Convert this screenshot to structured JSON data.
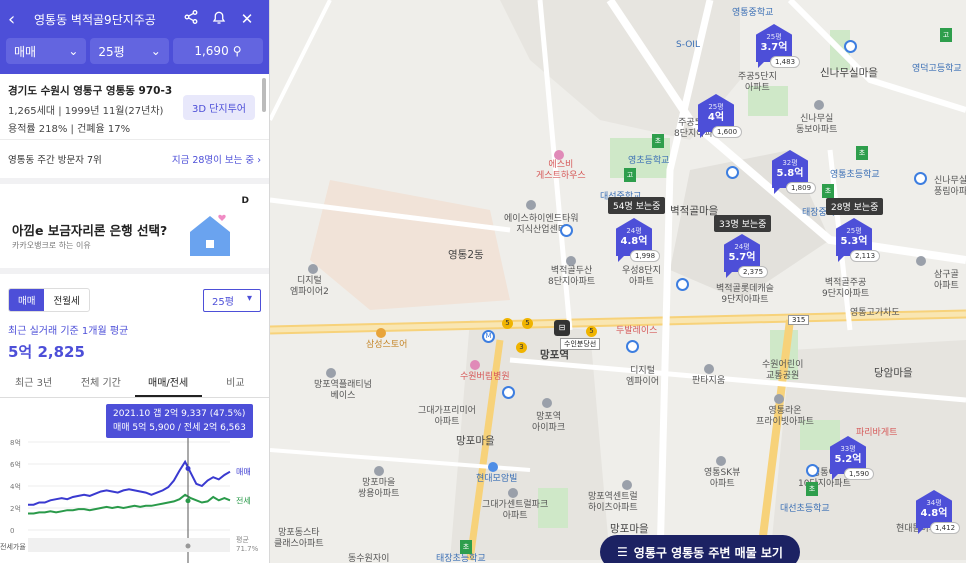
{
  "panel": {
    "header": {
      "title": "영통동 벽적골9단지주공",
      "back_icon": "‹",
      "share_icon": "share",
      "bell_icon": "bell",
      "close_icon": "✕"
    },
    "filters": {
      "deal_type": "매매",
      "area": "25평",
      "count": "1,690"
    },
    "address": {
      "line1": "경기도 수원시 영통구 영통동 970-3",
      "line2": "1,265세대 | 1999년 11월(27년차)",
      "line3": "용적률 218% | 건폐율 17%",
      "btn_3d": "3D 단지투어"
    },
    "visitors": {
      "rank": "영통동 주간 방문자 7위",
      "link": "지금 28명이 보는 중"
    },
    "ad": {
      "title": "아낌e 보금자리론 은행 선택?",
      "subtitle": "카카오뱅크로 하는 이유",
      "badge": "D"
    },
    "deal_tabs": {
      "sale": "매매",
      "lease": "전월세",
      "area_select": "25평"
    },
    "avg": {
      "label": "최근 실거래 기준 1개월 평균",
      "price": "5억 2,825"
    },
    "period_tabs": [
      "최근 3년",
      "전체 기간",
      "매매/전세",
      "비교"
    ],
    "tooltip": {
      "line1": "2021.10  갭 2억 9,337 (47.5%)",
      "line2": "매매 5억 5,900 / 전세 2억 6,563"
    }
  },
  "chart_data": {
    "type": "line",
    "y_ticks": [
      "8억",
      "6억",
      "4억",
      "2억",
      "0"
    ],
    "ylim": [
      0,
      8
    ],
    "series": [
      {
        "name": "매매",
        "color": "#3a3ad0",
        "values": [
          2.3,
          2.3,
          2.5,
          2.5,
          2.7,
          2.8,
          2.9,
          2.8,
          3.0,
          3.1,
          3.2,
          3.1,
          3.3,
          3.5,
          3.6,
          3.5,
          3.4,
          3.6,
          3.7,
          3.6,
          3.5,
          3.4,
          3.2,
          3.4,
          3.6,
          3.9,
          4.5,
          5.4,
          6.2,
          5.2,
          4.2,
          4.0,
          4.5,
          4.8,
          4.6,
          5.0,
          5.3
        ]
      },
      {
        "name": "전세",
        "color": "#2a9a4a",
        "values": [
          1.5,
          1.5,
          1.6,
          1.6,
          1.7,
          1.6,
          1.7,
          1.8,
          1.8,
          1.9,
          1.9,
          1.8,
          1.9,
          2.0,
          2.1,
          2.0,
          2.1,
          2.0,
          2.1,
          2.2,
          2.1,
          2.2,
          2.2,
          2.3,
          2.4,
          2.5,
          2.6,
          2.8,
          3.2,
          2.9,
          2.7,
          2.5,
          2.6,
          3.0,
          2.7,
          2.9,
          2.7
        ]
      },
      {
        "name": "전세가율",
        "color": "#999999",
        "values": []
      }
    ],
    "bottom_label": "전세가율",
    "bottom_value": "평균\n71.7%"
  },
  "map": {
    "labels": [
      {
        "t": "영통중학교",
        "c": "blue"
      },
      {
        "t": "S-OIL",
        "c": "blue"
      },
      {
        "t": "주공5단지\n아파트",
        "c": ""
      },
      {
        "t": "신나무실마을",
        "c": "big"
      },
      {
        "t": "영덕고등학교",
        "c": "blue"
      },
      {
        "t": "주공5단지\n8단지아파트",
        "c": ""
      },
      {
        "t": "신나무실\n동보아파트",
        "c": ""
      },
      {
        "t": "에스비\n게스트하우스",
        "c": "red"
      },
      {
        "t": "영초등학교",
        "c": "blue"
      },
      {
        "t": "대선중학교",
        "c": "blue"
      },
      {
        "t": "신나무실\n풍림아파",
        "c": ""
      },
      {
        "t": "태장중학교",
        "c": "blue"
      },
      {
        "t": "영통초등학교",
        "c": "blue"
      },
      {
        "t": "벽적골마을",
        "c": "big"
      },
      {
        "t": "에이스하이엔드타워\n지식산업센터",
        "c": ""
      },
      {
        "t": "영통2동",
        "c": "big"
      },
      {
        "t": "벽적골두산\n8단지아파트",
        "c": ""
      },
      {
        "t": "우성8단지\n아파트",
        "c": ""
      },
      {
        "t": "벽적골롯데캐슬\n9단지아파트",
        "c": ""
      },
      {
        "t": "벽적골주공\n9단지아파트",
        "c": ""
      },
      {
        "t": "삼구골\n아파트",
        "c": ""
      },
      {
        "t": "디지털\n엠파이어2",
        "c": ""
      },
      {
        "t": "영통역",
        "c": ""
      },
      {
        "t": "두발레이스",
        "c": "red"
      },
      {
        "t": "삼성스토어",
        "c": "orange"
      },
      {
        "t": "망포역",
        "c": "big"
      },
      {
        "t": "수원버림병원",
        "c": "red"
      },
      {
        "t": "디지털\n엠파이어",
        "c": ""
      },
      {
        "t": "판타지움",
        "c": ""
      },
      {
        "t": "수원어린이\n교통공원",
        "c": ""
      },
      {
        "t": "당암마을",
        "c": "big"
      },
      {
        "t": "망포역플래티넘\n베이스",
        "c": ""
      },
      {
        "t": "그대가프리미어\n아파트",
        "c": ""
      },
      {
        "t": "망포역\n아이파크",
        "c": ""
      },
      {
        "t": "영통라온\n프라이빗아파트",
        "c": ""
      },
      {
        "t": "파리바게트",
        "c": "red"
      },
      {
        "t": "망포마을",
        "c": "big"
      },
      {
        "t": "현대모암빌",
        "c": "blue"
      },
      {
        "t": "영통SK뷰\n아파트",
        "c": ""
      },
      {
        "t": "영통이\n10단지아파트",
        "c": ""
      },
      {
        "t": "망포마을\n쌍용아파트",
        "c": ""
      },
      {
        "t": "그대가센트럴파크\n아파트",
        "c": ""
      },
      {
        "t": "망포역센트럴\n하이츠아파트",
        "c": ""
      },
      {
        "t": "대선초등학교",
        "c": "blue"
      },
      {
        "t": "망포마을",
        "c": "big"
      },
      {
        "t": "동수원자이",
        "c": ""
      },
      {
        "t": "망포동스타\n클래스아파트",
        "c": ""
      },
      {
        "t": "태장초등학교",
        "c": "blue"
      },
      {
        "t": "현대뜰아파트",
        "c": ""
      },
      {
        "t": "영통고가차도",
        "c": ""
      },
      {
        "t": "수인분당선",
        "c": ""
      }
    ],
    "pins": [
      {
        "size": "25평",
        "price": "3.7억",
        "count": "1,483"
      },
      {
        "size": "25평",
        "price": "4억",
        "count": "1,600"
      },
      {
        "size": "32평",
        "price": "5.8억",
        "count": "1,809"
      },
      {
        "size": "24평",
        "price": "4.8억",
        "count": "1,998"
      },
      {
        "size": "24평",
        "price": "5.7억",
        "count": "2,375"
      },
      {
        "size": "25평",
        "price": "5.3억",
        "count": "2,113"
      },
      {
        "size": "33평",
        "price": "5.2억",
        "count": "1,590"
      },
      {
        "size": "34평",
        "price": "4.8억",
        "count": "1,412"
      }
    ],
    "viewing": [
      "54명 보는중",
      "33명 보는중",
      "28명 보는중"
    ],
    "road_number": "315",
    "cta": "영통구 영통동 주변 매물 보기",
    "school_flag": "초",
    "high_flag": "고"
  }
}
